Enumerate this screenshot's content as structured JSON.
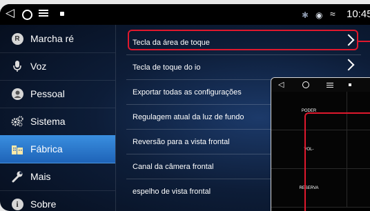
{
  "statusbar": {
    "time": "10:45",
    "icons": [
      "back-icon",
      "home-icon",
      "menu-icon",
      "app-icon",
      "bluetooth-icon",
      "location-icon",
      "wifi-icon"
    ]
  },
  "sidebar": {
    "items": [
      {
        "label": "Marcha ré",
        "icon": "reverse-r-icon"
      },
      {
        "label": "Voz",
        "icon": "microphone-icon"
      },
      {
        "label": "Pessoal",
        "icon": "person-icon"
      },
      {
        "label": "Sistema",
        "icon": "gears-icon"
      },
      {
        "label": "Fábrica",
        "icon": "factory-icon",
        "active": true
      },
      {
        "label": "Mais",
        "icon": "wrench-icon"
      },
      {
        "label": "Sobre",
        "icon": "info-icon"
      }
    ]
  },
  "settings": {
    "items": [
      {
        "label": "Tecla da área de toque",
        "has_arrow": true
      },
      {
        "label": "Tecla de toque do io",
        "has_arrow": true
      },
      {
        "label": "Exportar todas as configurações",
        "has_arrow": false
      },
      {
        "label": "Regulagem atual da luz de fundo",
        "has_arrow": false
      },
      {
        "label": "Reversão para a vista frontal",
        "has_arrow": false
      },
      {
        "label": "Canal da câmera frontal",
        "has_arrow": false
      },
      {
        "label": "espelho de vista frontal",
        "has_arrow": false
      }
    ]
  },
  "touch_popup": {
    "keys": [
      "PODER",
      "VOL-",
      "RESERVA"
    ]
  },
  "colors": {
    "highlight": "#e0182d",
    "active_tab": "#2a78d0"
  }
}
